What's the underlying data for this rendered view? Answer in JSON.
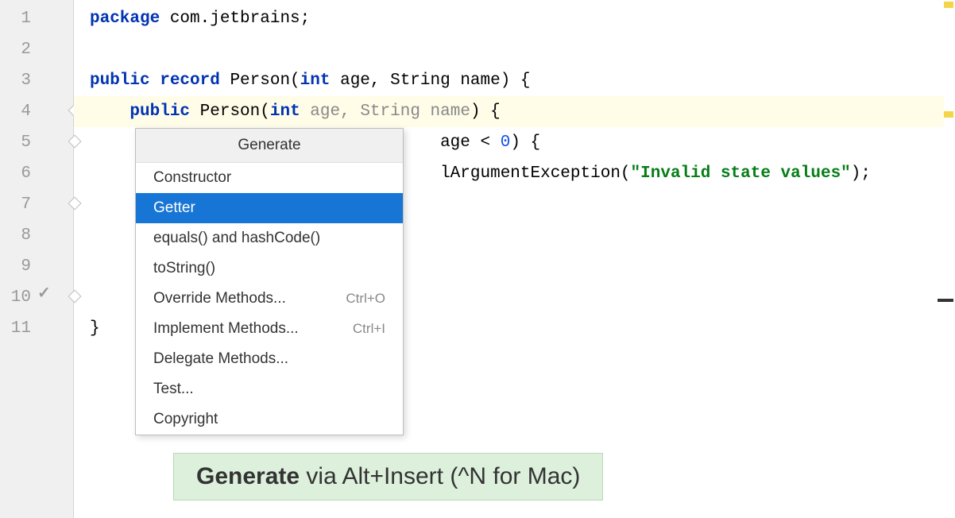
{
  "gutter": {
    "lines": [
      "1",
      "2",
      "3",
      "4",
      "5",
      "6",
      "7",
      "8",
      "9",
      "10",
      "11"
    ]
  },
  "code": {
    "line1": {
      "package_kw": "package",
      "pkg_name": " com.jetbrains",
      "semi": ";"
    },
    "line3": {
      "public_kw": "public ",
      "record_kw": "record",
      "name": " Person(",
      "int_kw": "int",
      "age": " age,",
      "string": " String name) {"
    },
    "line4": {
      "indent": "    ",
      "public_kw": "public",
      "name": " Person(",
      "int_kw": "int",
      "age_param": " age",
      "comma": ", ",
      "string_param": "String name",
      "close": ") {"
    },
    "line5": {
      "partial_visible": "age < ",
      "zero": "0",
      "close": ") {"
    },
    "line6": {
      "partial_visible": "lArgumentException(",
      "string_literal": "\"Invalid state values\"",
      "close": ");"
    },
    "line11": {
      "brace": "}"
    }
  },
  "popup": {
    "header": "Generate",
    "items": [
      {
        "label": "Constructor",
        "shortcut": "",
        "selected": false
      },
      {
        "label": "Getter",
        "shortcut": "",
        "selected": true
      },
      {
        "label": "equals() and hashCode()",
        "shortcut": "",
        "selected": false
      },
      {
        "label": "toString()",
        "shortcut": "",
        "selected": false
      },
      {
        "label": "Override Methods...",
        "shortcut": "Ctrl+O",
        "selected": false
      },
      {
        "label": "Implement Methods...",
        "shortcut": "Ctrl+I",
        "selected": false
      },
      {
        "label": "Delegate Methods...",
        "shortcut": "",
        "selected": false
      },
      {
        "label": "Test...",
        "shortcut": "",
        "selected": false
      },
      {
        "label": "Copyright",
        "shortcut": "",
        "selected": false
      }
    ]
  },
  "hint": {
    "bold": "Generate",
    "rest": " via Alt+Insert (^N for Mac)"
  }
}
